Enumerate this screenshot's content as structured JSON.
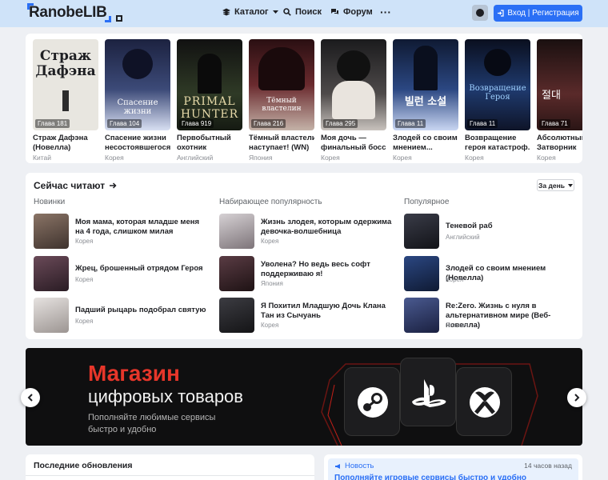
{
  "header": {
    "logo": "RanobeLIB",
    "nav": [
      {
        "label": "Каталог",
        "icon": "stack-icon"
      },
      {
        "label": "Поиск",
        "icon": "search-icon"
      },
      {
        "label": "Форум",
        "icon": "chat-icon"
      }
    ],
    "more_label": "···",
    "login_label": "Вход | Регистрация"
  },
  "popular": [
    {
      "title1": "Страж Дафэна",
      "title2": "(Новелла)",
      "country": "Китай",
      "chapter": "Глава 181",
      "cover_text": "Страж Дафэна",
      "bg": "#e8e6e0"
    },
    {
      "title1": "Спасение жизни",
      "title2": "несостоявшегося...",
      "country": "Корея",
      "chapter": "Глава 104",
      "cover_text": "Спасение жизни",
      "bg": "#2b3350"
    },
    {
      "title1": "Первобытный",
      "title2": "охотник",
      "country": "Английский",
      "chapter": "Глава 919",
      "cover_text": "PRIMAL HUNTER",
      "bg": "#23261f"
    },
    {
      "title1": "Тёмный властелин",
      "title2": "наступает! (WN)",
      "country": "Япония",
      "chapter": "Глава 216",
      "cover_text": "Тёмный властелин",
      "bg": "#4a1f22"
    },
    {
      "title1": "Моя дочь —",
      "title2": "финальный босс",
      "country": "Корея",
      "chapter": "Глава 295",
      "cover_text": "",
      "bg": "#3d3b3b"
    },
    {
      "title1": "Злодей со своим",
      "title2": "мнением...",
      "country": "Корея",
      "chapter": "Глава 11",
      "cover_text": "빌런 소설",
      "bg": "#1e2a4a"
    },
    {
      "title1": "Возвращение",
      "title2": "героя катастроф...",
      "country": "Корея",
      "chapter": "Глава 11",
      "cover_text": "Возвращение Героя",
      "bg": "#141c33"
    },
    {
      "title1": "Абсолютный",
      "title2": "Затворник",
      "country": "Корея",
      "chapter": "Глава 71",
      "cover_text": "절대",
      "bg": "#3a2222"
    }
  ],
  "reading": {
    "title": "Сейчас читают",
    "period": "За день",
    "columns": [
      {
        "heading": "Новинки",
        "items": [
          {
            "title": "Моя мама, которая младше меня на 4 года, слишком милая",
            "country": "Корея",
            "bg": "#6b5a52"
          },
          {
            "title": "Жрец, брошенный отрядом Героя",
            "country": "Корея",
            "bg": "#4a3340"
          },
          {
            "title": "Падший рыцарь подобрал святую",
            "country": "Корея",
            "bg": "#c9c5c3"
          }
        ]
      },
      {
        "heading": "Набирающее популярность",
        "items": [
          {
            "title": "Жизнь злодея, которым одержима девочка-волшебница",
            "country": "Корея",
            "bg": "#b9b4b8"
          },
          {
            "title": "Уволена? Но ведь весь софт поддерживаю я!",
            "country": "Япония",
            "bg": "#3a2a2e"
          },
          {
            "title": "Я Похитил Младшую Дочь Клана Тан из Сычуань",
            "country": "Корея",
            "bg": "#2a2a2e"
          }
        ]
      },
      {
        "heading": "Популярное",
        "items": [
          {
            "title": "Теневой раб",
            "country": "Английский",
            "bg": "#262832"
          },
          {
            "title": "Злодей со своим мнением (Новелла)",
            "country": "Корея",
            "bg": "#1e2a4a"
          },
          {
            "title": "Re:Zero. Жизнь с нуля в альтернативном мире (Веб-новелла)",
            "country": "Япония",
            "bg": "#2a3458"
          }
        ]
      }
    ]
  },
  "banner": {
    "line1": "Магазин",
    "line2": "цифровых товаров",
    "line3": "Пополняйте любимые сервисы быстро и удобно",
    "accent": "#e7362a"
  },
  "updates": {
    "title": "Последние обновления"
  },
  "news": {
    "tag": "Новость",
    "time": "14 часов назад",
    "text": "Пополняйте игровые сервисы быстро и удобно"
  },
  "colors": {
    "primary": "#2a6ff5",
    "header_bg": "#cfe3f9",
    "page_bg": "#eef0f4"
  }
}
